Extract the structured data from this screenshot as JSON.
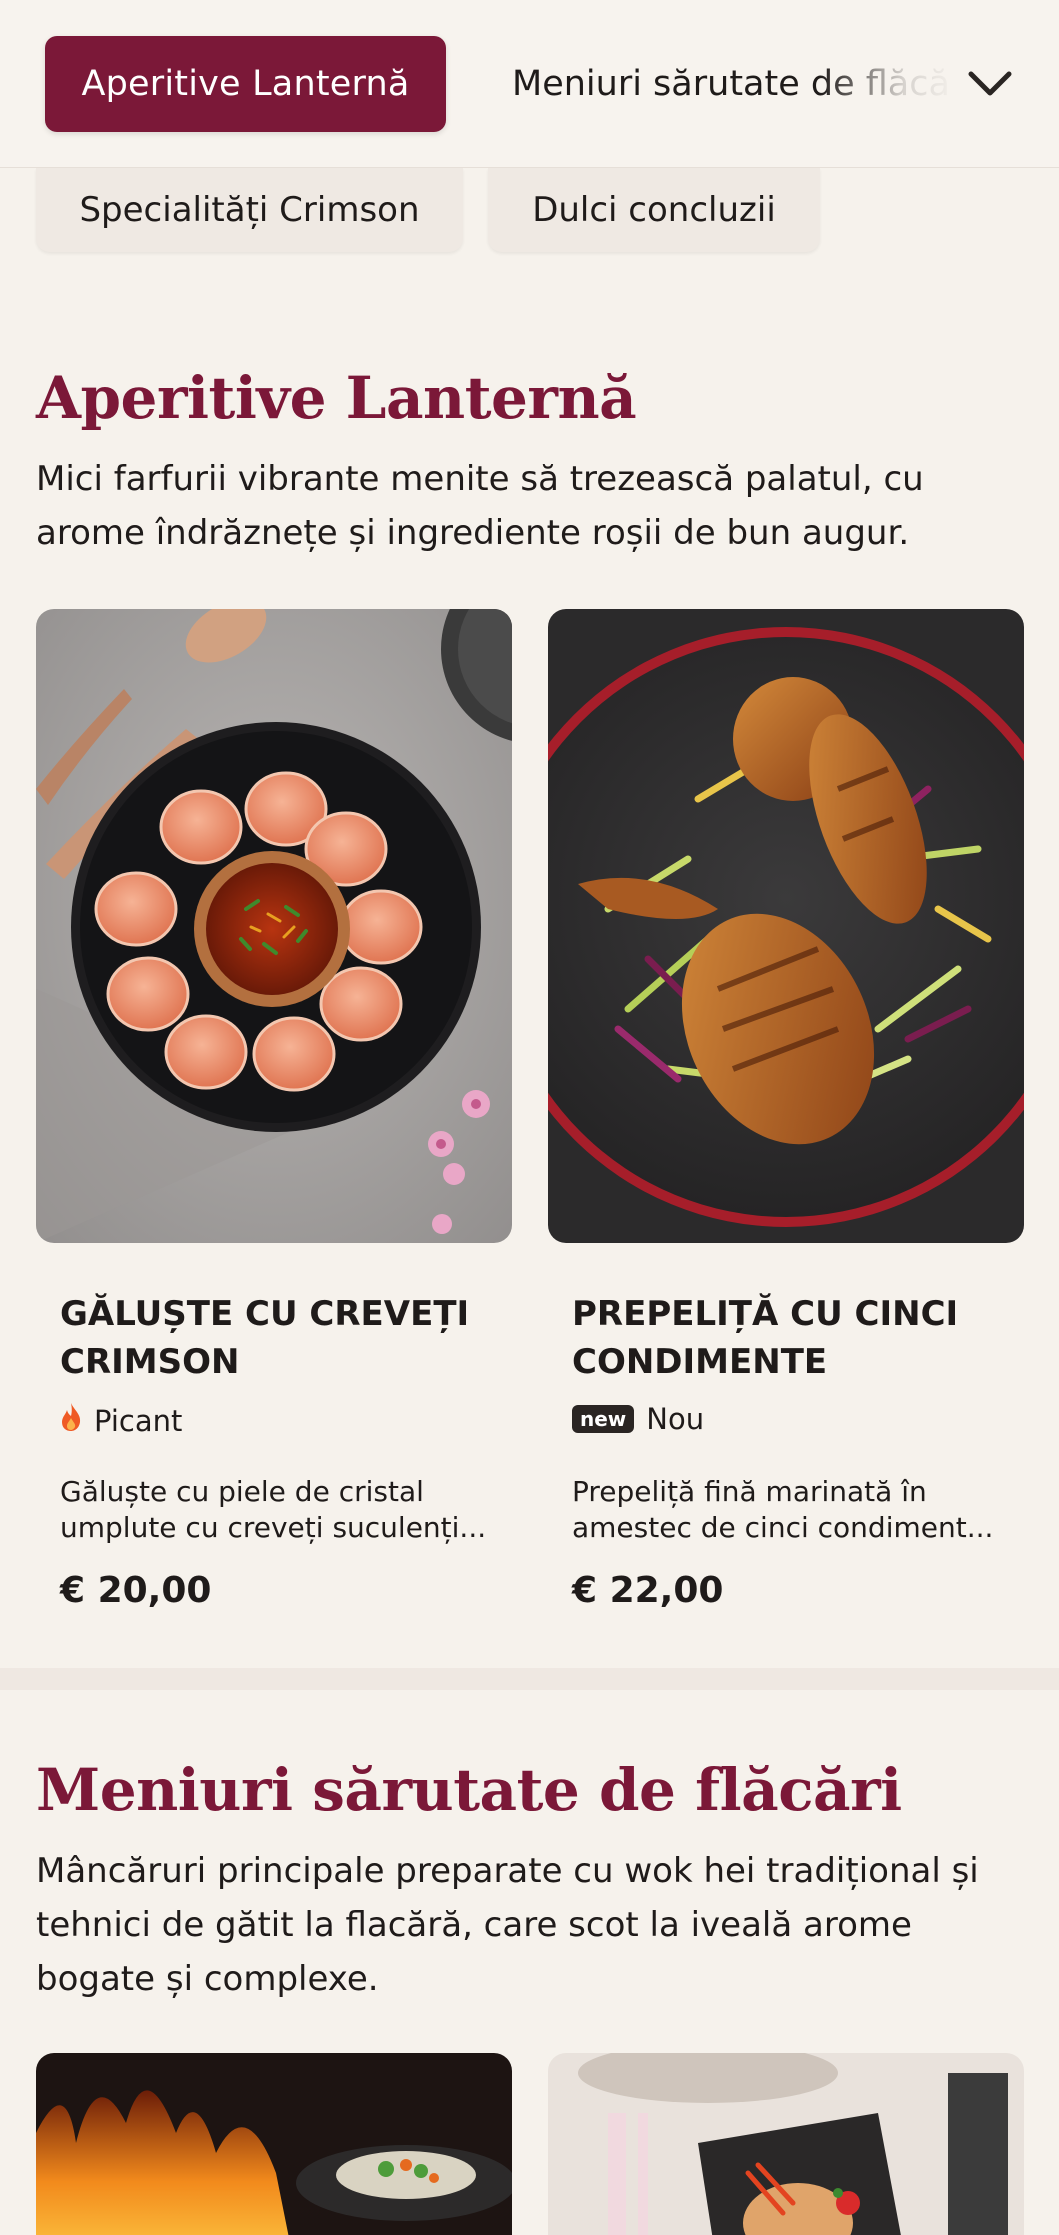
{
  "nav": {
    "active_tab": "Aperitive Lanternă",
    "next_tab": "Meniuri sărutate de flăcări",
    "row2_tabs": [
      "Specialități Crimson",
      "Dulci concluzii"
    ],
    "dropdown_icon": "chevron-down-icon"
  },
  "sections": [
    {
      "title": "Aperitive Lanternă",
      "description": "Mici farfurii vibrante menite să trezească palatul, cu arome îndrăznețe și ingrediente roșii de bun augur.",
      "items": [
        {
          "name": "Găluște cu creveți Crimson",
          "tag_icon": "flame-icon",
          "tag": "Picant",
          "description": "Găluște cu piele de cristal umplute cu creveți suculenți...",
          "price": "€ 20,00"
        },
        {
          "name": "Prepeliță cu cinci condimente",
          "tag_icon": "new-badge",
          "tag_badge": "new",
          "tag": "Nou",
          "description": "Prepeliță fină marinată în amestec de cinci condiment...",
          "price": "€ 22,00"
        }
      ]
    },
    {
      "title": "Meniuri sărutate de flăcări",
      "description": "Mâncăruri principale preparate cu wok hei tradițional și tehnici de gătit la flacără, care scot la iveală arome bogate și complexe."
    }
  ],
  "colors": {
    "accent": "#7b1838",
    "background": "#f6f2ec",
    "pill_inactive": "#efe9e3"
  }
}
